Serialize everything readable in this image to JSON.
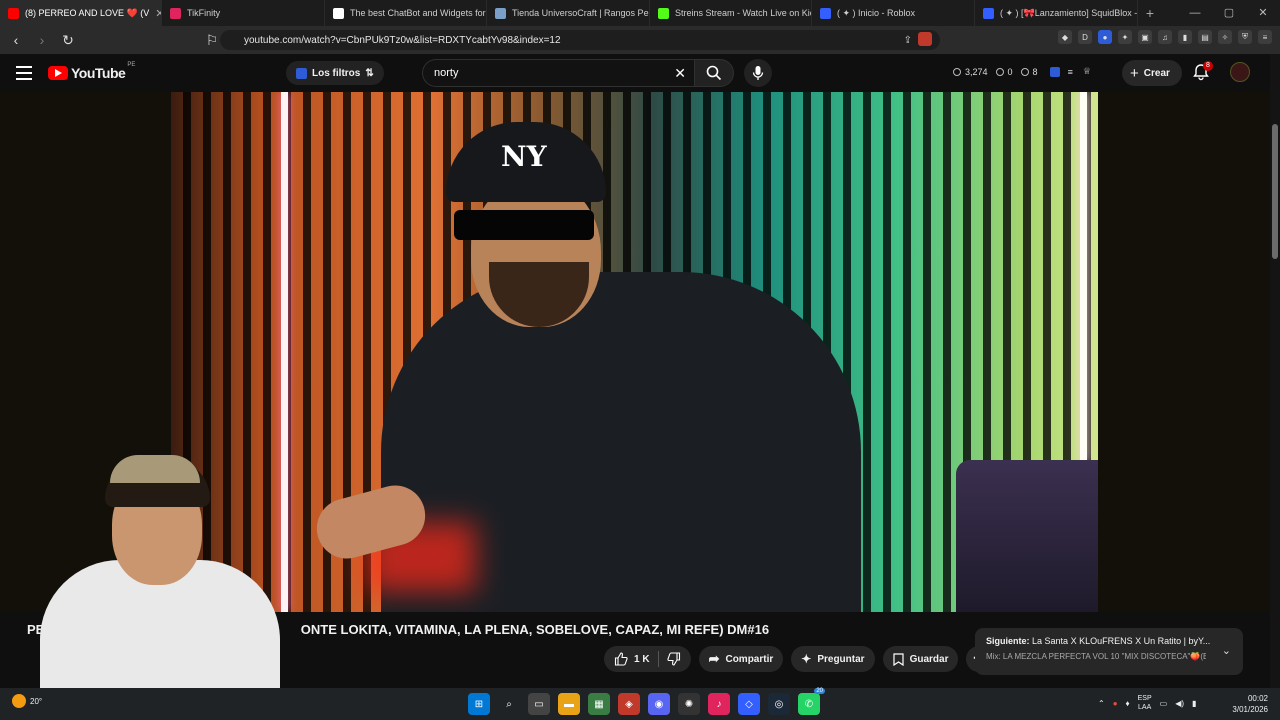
{
  "browser": {
    "tabs": [
      {
        "label": "(8) PERREO AND LOVE ❤️ (V",
        "color": "#ff0000",
        "active": true
      },
      {
        "label": "TikFinity",
        "color": "#e0245e",
        "active": false
      },
      {
        "label": "The best ChatBot and Widgets for K",
        "color": "#ffffff",
        "active": false
      },
      {
        "label": "Tienda UniversoCraft | Rangos Perm",
        "color": "#7aa0c8",
        "active": false
      },
      {
        "label": "Streins Stream - Watch Live on Kick",
        "color": "#53fc18",
        "active": false
      },
      {
        "label": "( ✦ ) Inicio - Roblox",
        "color": "#335fff",
        "active": false
      },
      {
        "label": "( ✦ ) [🎀Lanzamiento] SquidBlox - Ro",
        "color": "#335fff",
        "active": false
      }
    ],
    "url": "youtube.com/watch?v=CbnPUk9Tz0w&list=RDXTYcabtYv98&index=12"
  },
  "youtube": {
    "logo_text": "YouTube",
    "country_code": "PE",
    "filters_label": "Los filtros",
    "search_value": "norty",
    "stats": {
      "count": "3,274",
      "a": "0",
      "b": "8"
    },
    "create_label": "Crear",
    "notif_count": "8"
  },
  "video": {
    "title_start": "PERRE",
    "title_end": "ONTE LOKITA, VITAMINA, LA PLENA, SOBELOVE, CAPAZ, MI REFE) DM#16",
    "cap_logo": "NY",
    "likes": "1 K",
    "share_label": "Compartir",
    "ask_label": "Preguntar",
    "save_label": "Guardar"
  },
  "next_up": {
    "prefix": "Siguiente:",
    "title": "La Santa X KLOuFRENS X Un Ratito | byY...",
    "subtitle": "Mix: LA MEZCLA PERFECTA VOL 10 \"MIX DISCOTECA\"🍑(B..."
  },
  "taskbar": {
    "weather": "20°",
    "lang_1": "ESP",
    "lang_2": "LAA",
    "time": "00:02",
    "date": "3/01/2026",
    "whatsapp_badge": "20"
  }
}
